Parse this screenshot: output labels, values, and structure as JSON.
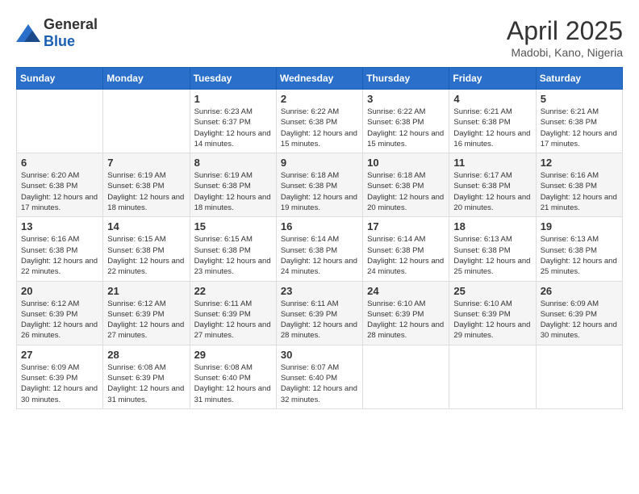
{
  "logo": {
    "general": "General",
    "blue": "Blue"
  },
  "header": {
    "month": "April 2025",
    "location": "Madobi, Kano, Nigeria"
  },
  "days_of_week": [
    "Sunday",
    "Monday",
    "Tuesday",
    "Wednesday",
    "Thursday",
    "Friday",
    "Saturday"
  ],
  "weeks": [
    [
      {
        "day": "",
        "info": ""
      },
      {
        "day": "",
        "info": ""
      },
      {
        "day": "1",
        "info": "Sunrise: 6:23 AM\nSunset: 6:37 PM\nDaylight: 12 hours and 14 minutes."
      },
      {
        "day": "2",
        "info": "Sunrise: 6:22 AM\nSunset: 6:38 PM\nDaylight: 12 hours and 15 minutes."
      },
      {
        "day": "3",
        "info": "Sunrise: 6:22 AM\nSunset: 6:38 PM\nDaylight: 12 hours and 15 minutes."
      },
      {
        "day": "4",
        "info": "Sunrise: 6:21 AM\nSunset: 6:38 PM\nDaylight: 12 hours and 16 minutes."
      },
      {
        "day": "5",
        "info": "Sunrise: 6:21 AM\nSunset: 6:38 PM\nDaylight: 12 hours and 17 minutes."
      }
    ],
    [
      {
        "day": "6",
        "info": "Sunrise: 6:20 AM\nSunset: 6:38 PM\nDaylight: 12 hours and 17 minutes."
      },
      {
        "day": "7",
        "info": "Sunrise: 6:19 AM\nSunset: 6:38 PM\nDaylight: 12 hours and 18 minutes."
      },
      {
        "day": "8",
        "info": "Sunrise: 6:19 AM\nSunset: 6:38 PM\nDaylight: 12 hours and 18 minutes."
      },
      {
        "day": "9",
        "info": "Sunrise: 6:18 AM\nSunset: 6:38 PM\nDaylight: 12 hours and 19 minutes."
      },
      {
        "day": "10",
        "info": "Sunrise: 6:18 AM\nSunset: 6:38 PM\nDaylight: 12 hours and 20 minutes."
      },
      {
        "day": "11",
        "info": "Sunrise: 6:17 AM\nSunset: 6:38 PM\nDaylight: 12 hours and 20 minutes."
      },
      {
        "day": "12",
        "info": "Sunrise: 6:16 AM\nSunset: 6:38 PM\nDaylight: 12 hours and 21 minutes."
      }
    ],
    [
      {
        "day": "13",
        "info": "Sunrise: 6:16 AM\nSunset: 6:38 PM\nDaylight: 12 hours and 22 minutes."
      },
      {
        "day": "14",
        "info": "Sunrise: 6:15 AM\nSunset: 6:38 PM\nDaylight: 12 hours and 22 minutes."
      },
      {
        "day": "15",
        "info": "Sunrise: 6:15 AM\nSunset: 6:38 PM\nDaylight: 12 hours and 23 minutes."
      },
      {
        "day": "16",
        "info": "Sunrise: 6:14 AM\nSunset: 6:38 PM\nDaylight: 12 hours and 24 minutes."
      },
      {
        "day": "17",
        "info": "Sunrise: 6:14 AM\nSunset: 6:38 PM\nDaylight: 12 hours and 24 minutes."
      },
      {
        "day": "18",
        "info": "Sunrise: 6:13 AM\nSunset: 6:38 PM\nDaylight: 12 hours and 25 minutes."
      },
      {
        "day": "19",
        "info": "Sunrise: 6:13 AM\nSunset: 6:38 PM\nDaylight: 12 hours and 25 minutes."
      }
    ],
    [
      {
        "day": "20",
        "info": "Sunrise: 6:12 AM\nSunset: 6:39 PM\nDaylight: 12 hours and 26 minutes."
      },
      {
        "day": "21",
        "info": "Sunrise: 6:12 AM\nSunset: 6:39 PM\nDaylight: 12 hours and 27 minutes."
      },
      {
        "day": "22",
        "info": "Sunrise: 6:11 AM\nSunset: 6:39 PM\nDaylight: 12 hours and 27 minutes."
      },
      {
        "day": "23",
        "info": "Sunrise: 6:11 AM\nSunset: 6:39 PM\nDaylight: 12 hours and 28 minutes."
      },
      {
        "day": "24",
        "info": "Sunrise: 6:10 AM\nSunset: 6:39 PM\nDaylight: 12 hours and 28 minutes."
      },
      {
        "day": "25",
        "info": "Sunrise: 6:10 AM\nSunset: 6:39 PM\nDaylight: 12 hours and 29 minutes."
      },
      {
        "day": "26",
        "info": "Sunrise: 6:09 AM\nSunset: 6:39 PM\nDaylight: 12 hours and 30 minutes."
      }
    ],
    [
      {
        "day": "27",
        "info": "Sunrise: 6:09 AM\nSunset: 6:39 PM\nDaylight: 12 hours and 30 minutes."
      },
      {
        "day": "28",
        "info": "Sunrise: 6:08 AM\nSunset: 6:39 PM\nDaylight: 12 hours and 31 minutes."
      },
      {
        "day": "29",
        "info": "Sunrise: 6:08 AM\nSunset: 6:40 PM\nDaylight: 12 hours and 31 minutes."
      },
      {
        "day": "30",
        "info": "Sunrise: 6:07 AM\nSunset: 6:40 PM\nDaylight: 12 hours and 32 minutes."
      },
      {
        "day": "",
        "info": ""
      },
      {
        "day": "",
        "info": ""
      },
      {
        "day": "",
        "info": ""
      }
    ]
  ]
}
